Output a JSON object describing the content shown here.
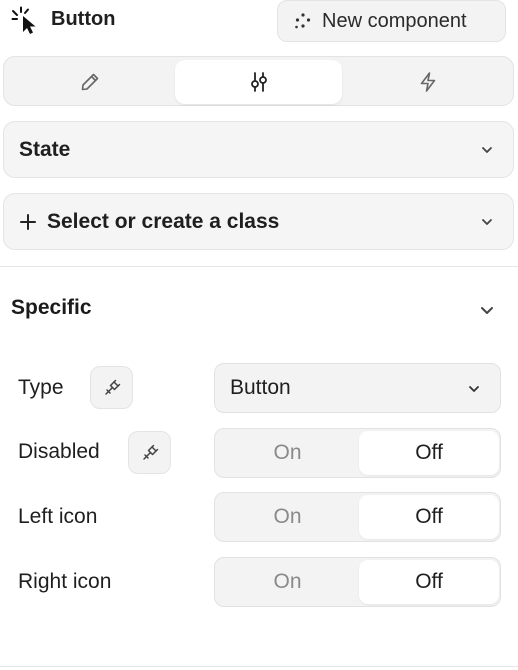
{
  "header": {
    "title": "Button",
    "new_component_label": "New component"
  },
  "tabs": [
    {
      "name": "pencil-icon",
      "selected": false
    },
    {
      "name": "sliders-icon",
      "selected": true
    },
    {
      "name": "lightning-icon",
      "selected": false
    }
  ],
  "state": {
    "label": "State"
  },
  "class_selector": {
    "label": "Select or create a class"
  },
  "section": {
    "title": "Specific"
  },
  "props": {
    "type": {
      "label": "Type",
      "value": "Button"
    },
    "disabled": {
      "label": "Disabled",
      "on": "On",
      "off": "Off",
      "selected": "Off"
    },
    "left_icon": {
      "label": "Left icon",
      "on": "On",
      "off": "Off",
      "selected": "Off"
    },
    "right_icon": {
      "label": "Right icon",
      "on": "On",
      "off": "Off",
      "selected": "Off"
    }
  },
  "colors": {
    "background": "#ffffff",
    "panel": "#f3f3f3",
    "border": "#e3e3e3",
    "muted_text": "#8a8a8a"
  }
}
